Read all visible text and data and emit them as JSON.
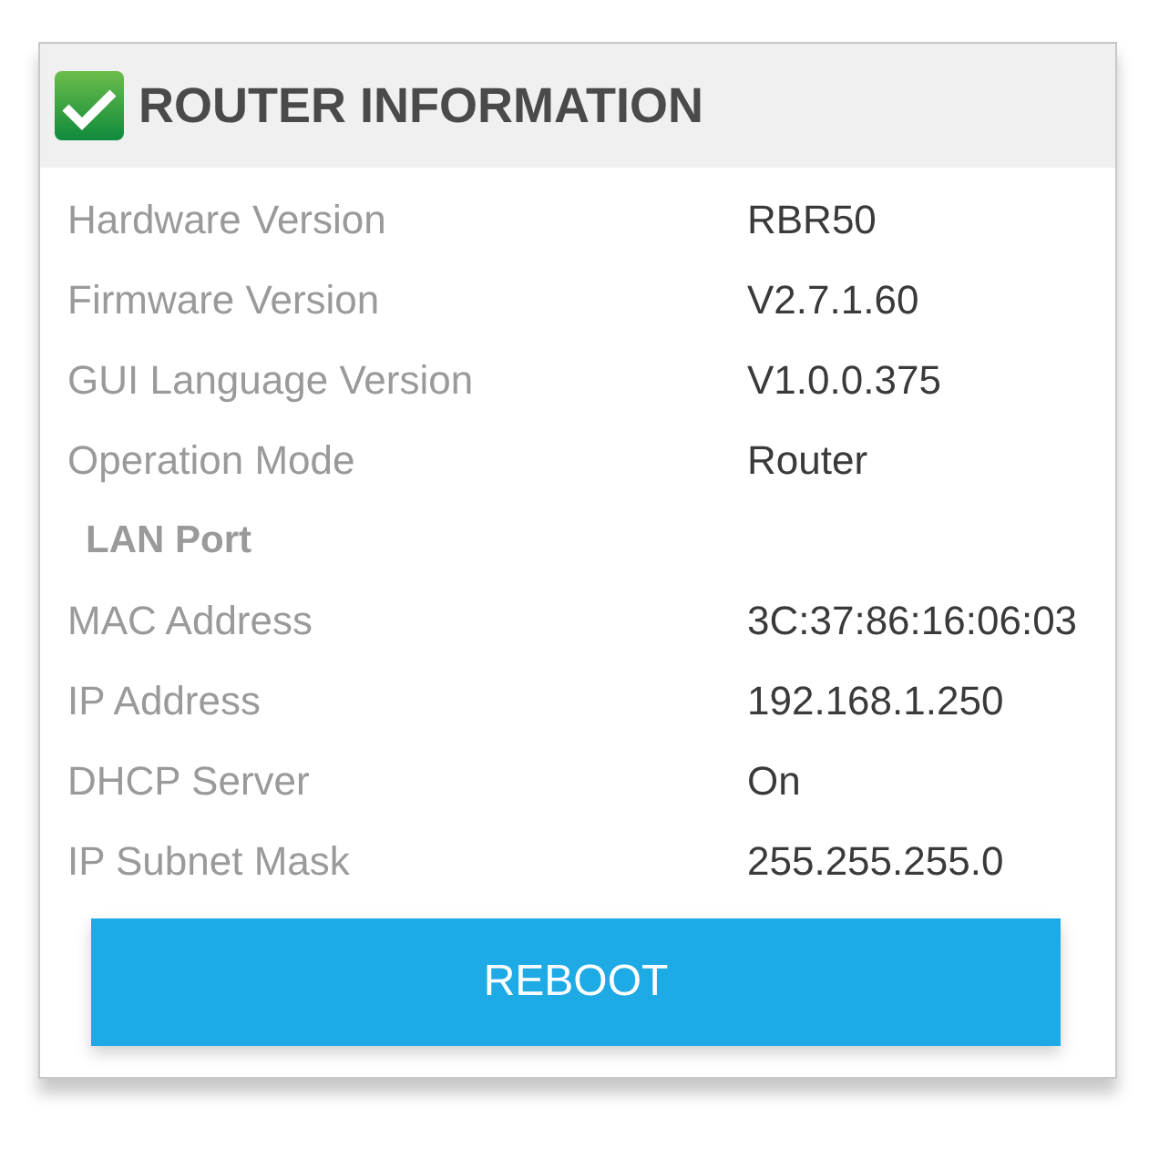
{
  "panel": {
    "title": "ROUTER INFORMATION",
    "rows": [
      {
        "kind": "field",
        "label": "Hardware Version",
        "value": "RBR50"
      },
      {
        "kind": "field",
        "label": "Firmware Version",
        "value": "V2.7.1.60"
      },
      {
        "kind": "field",
        "label": "GUI Language Version",
        "value": "V1.0.0.375"
      },
      {
        "kind": "field",
        "label": "Operation Mode",
        "value": "Router"
      },
      {
        "kind": "section",
        "label": "LAN Port"
      },
      {
        "kind": "field",
        "label": "MAC Address",
        "value": "3C:37:86:16:06:03"
      },
      {
        "kind": "field",
        "label": "IP Address",
        "value": "192.168.1.250"
      },
      {
        "kind": "field",
        "label": "DHCP Server",
        "value": "On"
      },
      {
        "kind": "field",
        "label": "IP Subnet Mask",
        "value": "255.255.255.0"
      }
    ],
    "button": "REBOOT"
  }
}
